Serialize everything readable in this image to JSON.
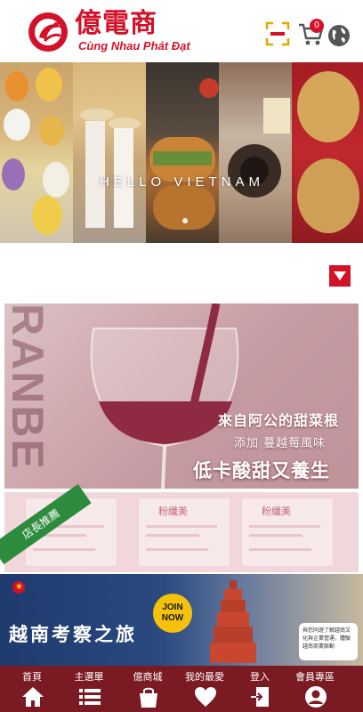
{
  "brand": {
    "title": "億電商",
    "subtitle": "Cùng Nhau Phát Đạt",
    "accent": "#d3122a"
  },
  "header": {
    "cart_count": "0",
    "icons": [
      "scan-icon",
      "cart-icon",
      "globe-icon"
    ]
  },
  "hero": {
    "title": "HELLO VIETNAM",
    "slide_indicator": "1"
  },
  "wine_promo": {
    "bg_word": "RANBE",
    "line1": "來自阿公的甜菜根",
    "line2": "添加 蔓越莓風味",
    "line3": "低卡酸甜又養生"
  },
  "recommended": {
    "ribbon": "店長推薦",
    "brand_label": "粉纖美"
  },
  "tour": {
    "title": "越南考察之旅",
    "join": "JOIN NOW",
    "note": "與您同遊了解越南文化與企業營運，體驗越南商業脈動"
  },
  "bottom_nav": {
    "color": "#7a1a22",
    "items": [
      {
        "label": "首頁",
        "icon": "home-icon"
      },
      {
        "label": "主選單",
        "icon": "menu-icon"
      },
      {
        "label": "億商城",
        "icon": "shopping-bag-icon"
      },
      {
        "label": "我的最愛",
        "icon": "heart-icon"
      },
      {
        "label": "登入",
        "icon": "login-icon"
      },
      {
        "label": "會員專區",
        "icon": "user-icon"
      }
    ]
  }
}
